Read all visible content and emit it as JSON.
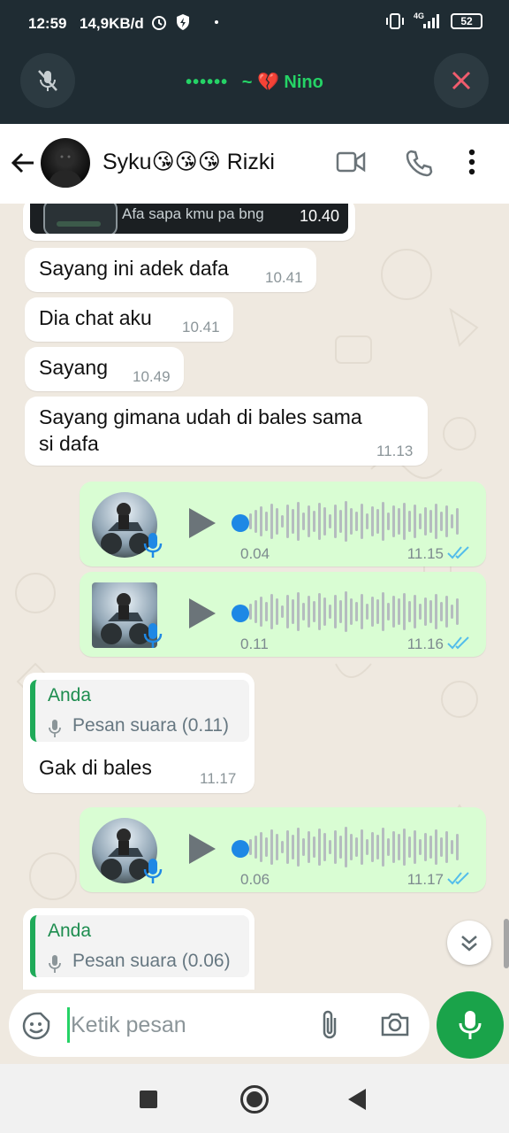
{
  "status_bar": {
    "time": "12:59",
    "network_speed": "14,9KB/d",
    "signal_label": "4G",
    "battery": "52"
  },
  "call_banner": {
    "dots": "••••••",
    "caller": "~ 💔 Nino"
  },
  "header": {
    "contact_name": "Syku😘😘😘 Rizki"
  },
  "messages": [
    {
      "type": "image",
      "direction": "in",
      "caption": "Afa sapa kmu pa bng",
      "time": "10.40"
    },
    {
      "type": "text",
      "direction": "in",
      "text": "Sayang ini adek dafa",
      "time": "10.41"
    },
    {
      "type": "text",
      "direction": "in",
      "text": "Dia chat aku",
      "time": "10.41"
    },
    {
      "type": "text",
      "direction": "in",
      "text": "Sayang",
      "time": "10.49"
    },
    {
      "type": "text",
      "direction": "in",
      "text_line1": "Sayang gimana udah di bales sama",
      "text_line2": "si dafa",
      "time": "11.13"
    },
    {
      "type": "voice",
      "direction": "out",
      "duration": "0.04",
      "time": "11.15",
      "status": "read"
    },
    {
      "type": "voice",
      "direction": "out",
      "duration": "0.11",
      "time": "11.16",
      "status": "read"
    },
    {
      "type": "reply",
      "direction": "in",
      "quoted_author": "Anda",
      "quoted_text": "Pesan suara (0.11)",
      "text": "Gak di bales",
      "time": "11.17"
    },
    {
      "type": "voice",
      "direction": "out",
      "duration": "0.06",
      "time": "11.17",
      "status": "read"
    },
    {
      "type": "reply",
      "direction": "in",
      "quoted_author": "Anda",
      "quoted_text": "Pesan suara (0.06)"
    }
  ],
  "input": {
    "placeholder": "Ketik pesan"
  },
  "colors": {
    "header_bar": "#1f2c33",
    "accent_green": "#25d366",
    "outgoing_bubble": "#d9fdd3",
    "incoming_bubble": "#ffffff",
    "read_tick": "#53bdeb",
    "end_call_red": "#f15c6d"
  }
}
